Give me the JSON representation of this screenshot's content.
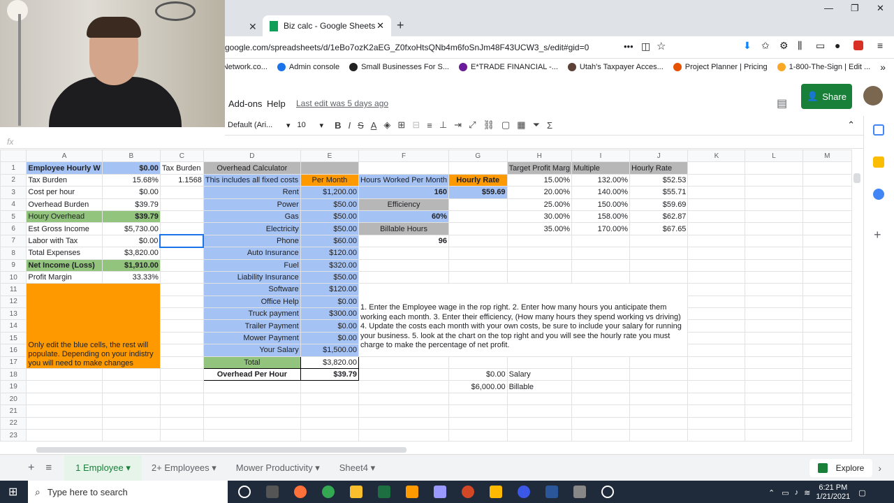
{
  "browser": {
    "tab_title": "Biz calc - Google Sheets",
    "url": "google.com/spreadsheets/d/1eBo7ozK2aEG_Z0fxoHtsQNb4m6foSnJm48F43UCW3_s/edit#gid=0",
    "bookmarks": [
      "iProRealtyNetwork.co...",
      "Admin console",
      "Small Businesses For S...",
      "E*TRADE FINANCIAL -...",
      "Utah's Taxpayer Acces...",
      "Project Planner | Pricing",
      "1-800-The-Sign | Edit ..."
    ]
  },
  "sheets": {
    "menu": [
      "Add-ons",
      "Help"
    ],
    "last_edit": "Last edit was 5 days ago",
    "share_label": "Share",
    "font": "Default (Ari...",
    "font_size": "10",
    "fx": "fx",
    "columns": [
      "A",
      "B",
      "C",
      "D",
      "E",
      "F",
      "G",
      "H",
      "I",
      "J",
      "K",
      "L",
      "M"
    ],
    "tabs": [
      "1 Employee",
      "2+ Employees",
      "Mower Productivity",
      "Sheet4"
    ],
    "explore": "Explore"
  },
  "cells": {
    "a1": "Employee Hourly W",
    "b1": "$0.00",
    "c1": "Tax Burden",
    "d1": "Overhead Calculator",
    "h1": "Target Profit Marg",
    "i1": "Multiple",
    "j1": "Hourly Rate",
    "a2": "Tax Burden",
    "b2": "15.68%",
    "c2": "1.1568",
    "d2": "This includes all fixed costs",
    "e2": "Per Month",
    "f2": "Hours Worked Per Month",
    "g2": "Hourly Rate",
    "h2": "15.00%",
    "i2": "132.00%",
    "j2": "$52.53",
    "a3": "Cost per hour",
    "b3": "$0.00",
    "d3": "Rent",
    "e3": "$1,200.00",
    "f3": "160",
    "g3": "$59.69",
    "h3": "20.00%",
    "i3": "140.00%",
    "j3": "$55.71",
    "a4": "Overhead Burden",
    "b4": "$39.79",
    "d4": "Power",
    "e4": "$50.00",
    "f4": "Efficiency",
    "h4": "25.00%",
    "i4": "150.00%",
    "j4": "$59.69",
    "a5": "Houry Overhead",
    "b5": "$39.79",
    "d5": "Gas",
    "e5": "$50.00",
    "f5": "60%",
    "h5": "30.00%",
    "i5": "158.00%",
    "j5": "$62.87",
    "a6": "Est Gross Income",
    "b6": "$5,730.00",
    "d6": "Electricity",
    "e6": "$50.00",
    "f6": "Billable Hours",
    "h6": "35.00%",
    "i6": "170.00%",
    "j6": "$67.65",
    "a7": "Labor with Tax",
    "b7": "$0.00",
    "d7": "Phone",
    "e7": "$60.00",
    "f7": "96",
    "a8": "Total Expenses",
    "b8": "$3,820.00",
    "d8": "Auto Insurance",
    "e8": "$120.00",
    "a9": "Net Income (Loss)",
    "b9": "$1,910.00",
    "d9": "Fuel",
    "e9": "$320.00",
    "a10": "Profit Margin",
    "b10": "33.33%",
    "d10": "Liability Insurance",
    "e10": "$50.00",
    "d11": "Software",
    "e11": "$120.00",
    "d12": "Office Help",
    "e12": "$0.00",
    "d13": "Truck payment",
    "e13": "$300.00",
    "d14": "Trailer Payment",
    "e14": "$0.00",
    "d15": "Mower Payment",
    "e15": "$0.00",
    "a16": "Only edit the blue cells, the rest will populate. Depending on your indistry you will need to make changes",
    "d16": "Your Salary",
    "e16": "$1,500.00",
    "f12": "1. Enter the Employee wage in the rop right. 2. Enter how many hours you anticipate them working each month. 3. Enter their efficiency, (How many hours they spend working vs driving) 4. Update the costs each month with your own costs, be sure to include your salary for running your business. 5. look at the chart on the top right and you will see the hourly rate you must charge to make the percentage of net profit.",
    "d17": "Total",
    "e17": "$3,820.00",
    "d18": "Overhead Per Hour",
    "e18": "$39.79",
    "g18": "$0.00",
    "h18": "Salary",
    "g19": "$6,000.00",
    "h19": "Billable"
  },
  "taskbar": {
    "search": "Type here to search",
    "time": "6:21 PM",
    "date": "1/21/2021"
  },
  "colors": {
    "blue": "#a4c2f4",
    "green": "#93c47d",
    "orange": "#ff9900",
    "gray": "#b7b7b7",
    "share": "#188038"
  }
}
